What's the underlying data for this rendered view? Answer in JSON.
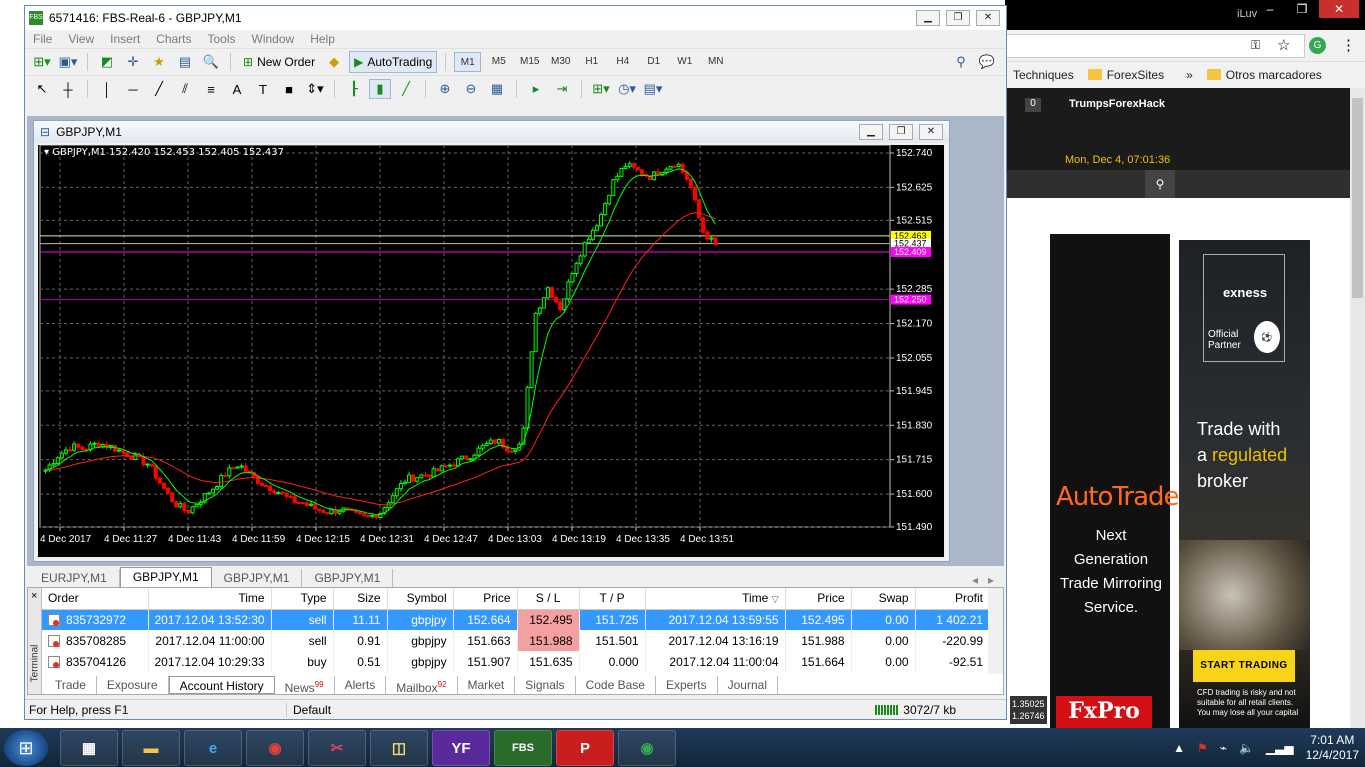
{
  "browser": {
    "app_title": "iLuv",
    "bookmarks": [
      "Techniques",
      "ForexSites",
      "Otros marcadores"
    ],
    "overflow": "»",
    "site_badge": "0",
    "site_brand": "TrumpsForexHack",
    "site_datetime": "Mon, Dec 4, 07:01:36",
    "search_icon": "magnifier-icon"
  },
  "ads": {
    "fxpro": {
      "headline": "AutoTrade",
      "line1": "Next Generation",
      "line2": "Trade Mirroring",
      "line3": "Service.",
      "logo": "FxPro",
      "quote1": "1.35025",
      "quote2": "1.26746"
    },
    "exness": {
      "brand": "exness",
      "partner1": "Official",
      "partner2": "Partner",
      "trade1": "Trade with",
      "trade2a": "a",
      "trade2b": "regulated",
      "trade3": "broker",
      "button": "START TRADING",
      "disclaimer": "CFD trading is risky and not suitable for all retail clients. You may lose all your capital"
    }
  },
  "mt4": {
    "title": "6571416: FBS-Real-6 - GBPJPY,M1",
    "logo": "FBS",
    "menu": [
      "File",
      "View",
      "Insert",
      "Charts",
      "Tools",
      "Window",
      "Help"
    ],
    "toolbar": {
      "new_order": "New Order",
      "autotrading": "AutoTrading",
      "timeframes": [
        "M1",
        "M5",
        "M15",
        "M30",
        "H1",
        "H4",
        "D1",
        "W1",
        "MN"
      ],
      "active_tf": "M1"
    },
    "chart_window_title": "GBPJPY,M1",
    "chart_tabs": [
      "EURJPY,M1",
      "GBPJPY,M1",
      "GBPJPY,M1",
      "GBPJPY,M1"
    ],
    "active_chart_tab": 1,
    "terminal": {
      "side_label": "Terminal",
      "close": "×",
      "columns": [
        "Order",
        "Time",
        "Type",
        "Size",
        "Symbol",
        "Price",
        "S / L",
        "T / P",
        "Time",
        "Price",
        "Swap",
        "Profit"
      ],
      "rows": [
        [
          "835732972",
          "2017.12.04 13:52:30",
          "sell",
          "11.11",
          "gbpjpy",
          "152.664",
          "152.495",
          "151.725",
          "2017.12.04 13:59:55",
          "152.495",
          "0.00",
          "1 402.21"
        ],
        [
          "835708285",
          "2017.12.04 11:00:00",
          "sell",
          "0.91",
          "gbpjpy",
          "151.663",
          "151.988",
          "151.501",
          "2017.12.04 13:16:19",
          "151.988",
          "0.00",
          "-220.99"
        ],
        [
          "835704126",
          "2017.12.04 10:29:33",
          "buy",
          "0.51",
          "gbpjpy",
          "151.907",
          "151.635",
          "0.000",
          "2017.12.04 11:00:04",
          "151.664",
          "0.00",
          "-92.51"
        ]
      ],
      "tabs": [
        {
          "label": "Trade",
          "badge": ""
        },
        {
          "label": "Exposure",
          "badge": ""
        },
        {
          "label": "Account History",
          "badge": ""
        },
        {
          "label": "News",
          "badge": "99"
        },
        {
          "label": "Alerts",
          "badge": ""
        },
        {
          "label": "Mailbox",
          "badge": "92"
        },
        {
          "label": "Market",
          "badge": ""
        },
        {
          "label": "Signals",
          "badge": ""
        },
        {
          "label": "Code Base",
          "badge": ""
        },
        {
          "label": "Experts",
          "badge": ""
        },
        {
          "label": "Journal",
          "badge": ""
        }
      ],
      "active_tab": 2
    },
    "status": {
      "help": "For Help, press F1",
      "profile": "Default",
      "connection": "3072/7 kb"
    }
  },
  "chart_data": {
    "type": "candlestick",
    "symbol_header": "GBPJPY,M1  152.420 152.453 152.405 152.437",
    "y_ticks": [
      "152.740",
      "152.625",
      "152.515",
      "152.285",
      "152.170",
      "152.055",
      "151.945",
      "151.830",
      "151.715",
      "151.600",
      "151.490"
    ],
    "ylim": [
      151.49,
      152.74
    ],
    "x_ticks": [
      "4 Dec 2017",
      "4 Dec 11:27",
      "4 Dec 11:43",
      "4 Dec 11:59",
      "4 Dec 12:15",
      "4 Dec 12:31",
      "4 Dec 12:47",
      "4 Dec 13:03",
      "4 Dec 13:19",
      "4 Dec 13:35",
      "4 Dec 13:51"
    ],
    "price_labels": [
      {
        "text": "152.463",
        "value": 152.463,
        "color": "#ffff00"
      },
      {
        "text": "152.437",
        "value": 152.437,
        "color": "#ffffff"
      },
      {
        "text": "152.409",
        "value": 152.409,
        "color": "#ff00ff"
      },
      {
        "text": "152.250",
        "value": 152.25,
        "color": "#ff00ff"
      }
    ],
    "horizontal_lines": [
      {
        "value": 152.463,
        "color": "#e8e8a0"
      },
      {
        "value": 152.437,
        "color": "#bbbbbb"
      },
      {
        "value": 152.409,
        "color": "#ff00ff"
      },
      {
        "value": 152.25,
        "color": "#c000c0"
      }
    ],
    "close_path": [
      151.68,
      151.73,
      151.76,
      151.75,
      151.77,
      151.76,
      151.74,
      151.72,
      151.7,
      151.63,
      151.57,
      151.54,
      151.58,
      151.62,
      151.67,
      151.7,
      151.66,
      151.63,
      151.61,
      151.58,
      151.57,
      151.55,
      151.54,
      151.55,
      151.53,
      151.52,
      151.54,
      151.6,
      151.65,
      151.66,
      151.67,
      151.69,
      151.71,
      151.73,
      151.76,
      151.78,
      151.75,
      151.77,
      152.2,
      152.29,
      152.22,
      152.36,
      152.45,
      152.52,
      152.64,
      152.7,
      152.68,
      152.66,
      152.69,
      152.71,
      152.64,
      152.48,
      152.43
    ],
    "ma_fast_color": "#00ff00",
    "ma_slow_color": "#ff2020",
    "grid": true,
    "colors": {
      "background": "#000000",
      "bull": "#00ff00",
      "bear": "#ff0000",
      "axis_text": "#ffffff"
    }
  }
}
